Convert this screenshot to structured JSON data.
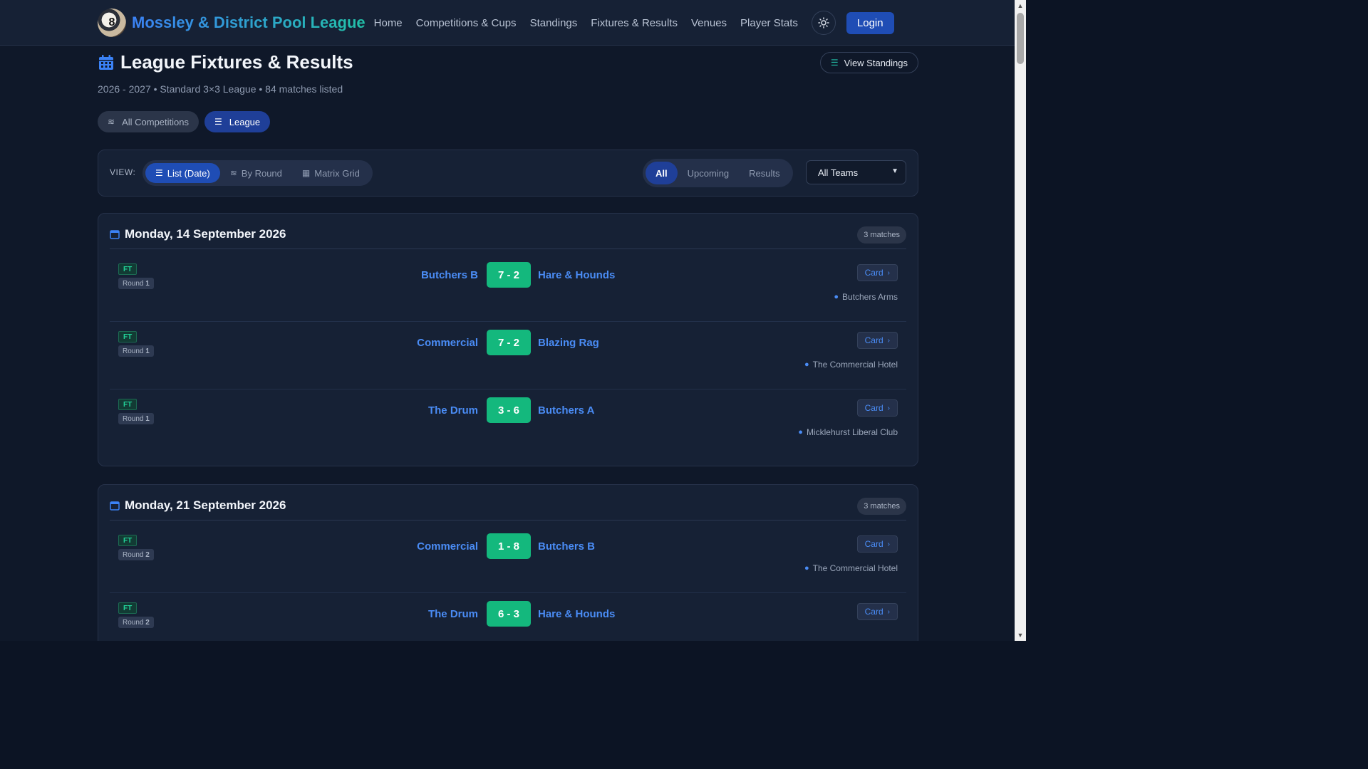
{
  "nav": {
    "brand": "Mossley & District Pool League",
    "links": [
      "Home",
      "Competitions & Cups",
      "Standings",
      "Fixtures & Results",
      "Venues",
      "Player Stats"
    ],
    "login": "Login"
  },
  "header": {
    "title": "League Fixtures & Results",
    "view_standings": "View Standings",
    "subtitle": "2026 - 2027 • Standard 3×3 League • 84 matches listed"
  },
  "competition_pills": [
    "All Competitions",
    "League"
  ],
  "filters": {
    "view_label": "VIEW:",
    "view_options": [
      "List (Date)",
      "By Round",
      "Matrix Grid"
    ],
    "status_options": [
      "All",
      "Upcoming",
      "Results"
    ],
    "team_select": "All Teams"
  },
  "days": [
    {
      "date": "Monday, 14 September 2026",
      "count": "3 matches",
      "matches": [
        {
          "status": "FT",
          "round_label": "Round",
          "round_num": "1",
          "home": "Butchers B",
          "score": "7 - 2",
          "away": "Hare & Hounds",
          "card": "Card",
          "venue": "Butchers Arms"
        },
        {
          "status": "FT",
          "round_label": "Round",
          "round_num": "1",
          "home": "Commercial",
          "score": "7 - 2",
          "away": "Blazing Rag",
          "card": "Card",
          "venue": "The Commercial Hotel"
        },
        {
          "status": "FT",
          "round_label": "Round",
          "round_num": "1",
          "home": "The Drum",
          "score": "3 - 6",
          "away": "Butchers A",
          "card": "Card",
          "venue": "Micklehurst Liberal Club"
        }
      ]
    },
    {
      "date": "Monday, 21 September 2026",
      "count": "3 matches",
      "matches": [
        {
          "status": "FT",
          "round_label": "Round",
          "round_num": "2",
          "home": "Commercial",
          "score": "1 - 8",
          "away": "Butchers B",
          "card": "Card",
          "venue": "The Commercial Hotel"
        },
        {
          "status": "FT",
          "round_label": "Round",
          "round_num": "2",
          "home": "The Drum",
          "score": "6 - 3",
          "away": "Hare & Hounds",
          "card": "Card",
          "venue": ""
        }
      ]
    }
  ]
}
